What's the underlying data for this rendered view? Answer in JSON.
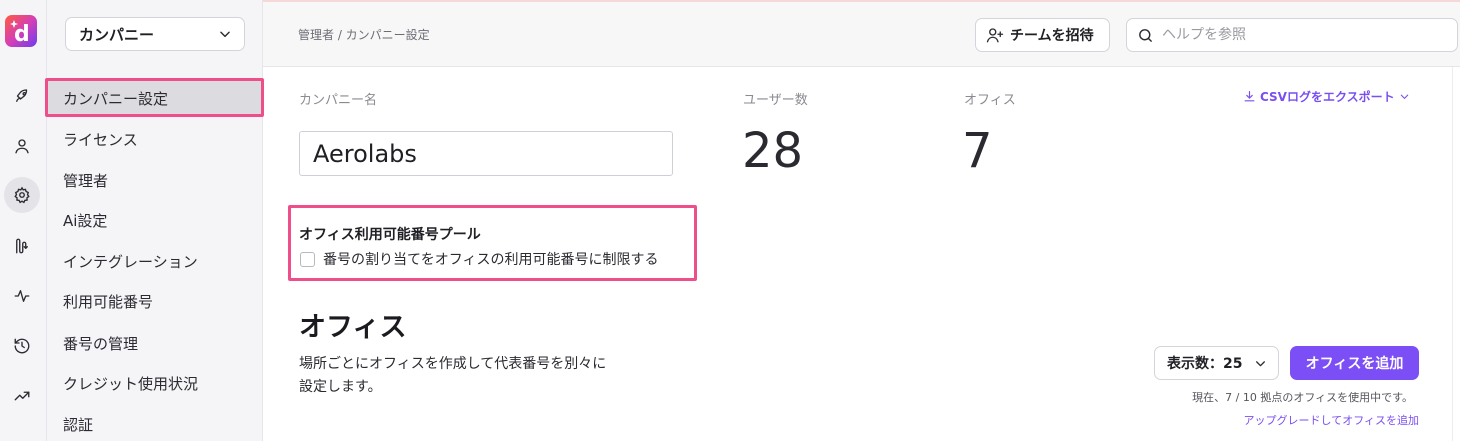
{
  "rail": {
    "logo_letter": "d",
    "items": [
      "rocket-icon",
      "user-icon",
      "gear-icon",
      "route-icon",
      "activity-icon",
      "history-icon",
      "trending-icon"
    ],
    "active_index": 2
  },
  "nav": {
    "company_select": "カンパニー",
    "items": [
      {
        "label": "カンパニー設定",
        "active": true
      },
      {
        "label": "ライセンス"
      },
      {
        "label": "管理者"
      },
      {
        "label": "Ai設定"
      },
      {
        "label": "インテグレーション"
      },
      {
        "label": "利用可能番号"
      },
      {
        "label": "番号の管理"
      },
      {
        "label": "クレジット使用状況"
      },
      {
        "label": "認証"
      }
    ]
  },
  "header": {
    "breadcrumb": "管理者 / カンパニー設定",
    "invite_label": "チームを招待",
    "search_placeholder": "ヘルプを参照"
  },
  "main": {
    "company_name_label": "カンパニー名",
    "company_name_value": "Aerolabs",
    "users_label": "ユーザー数",
    "users_count": "28",
    "offices_label": "オフィス",
    "offices_count": "7",
    "export_label": "CSVログをエクスポート",
    "pool_title": "オフィス利用可能番号プール",
    "pool_checkbox_label": "番号の割り当てをオフィスの利用可能番号に制限する",
    "pool_checked": false,
    "section_title": "オフィス",
    "section_desc_line1": "場所ごとにオフィスを作成して代表番号を別々に",
    "section_desc_line2": "設定します。",
    "perpage_label": "表示数：25",
    "add_office_label": "オフィスを追加",
    "usage_text": "現在、7 / 10 拠点のオフィスを使用中です。",
    "upgrade_link": "アップグレードしてオフィスを追加"
  },
  "colors": {
    "accent": "#7c4ef5",
    "highlight": "#ee4f8b"
  }
}
